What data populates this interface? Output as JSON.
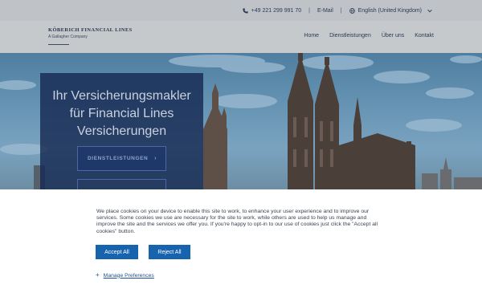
{
  "topbar": {
    "phone": "+49 221 299 991 70",
    "separator": "|",
    "email_label": "E-Mail",
    "language": "English (United Kingdom)"
  },
  "header": {
    "logo_name": "KÖBERICH FINANCIAL LINES",
    "logo_sub": "A Gallagher Company",
    "nav": [
      "Home",
      "Dienstleistungen",
      "Über uns",
      "Kontakt"
    ]
  },
  "hero": {
    "title_lines": [
      "Ihr Versicherungsmakler",
      "für Financial Lines",
      "Versicherungen"
    ],
    "button_label": "DIENSTLEISTUNGEN",
    "button_arrow": "›"
  },
  "cookie": {
    "text": "We place cookies on your device to enable this site to work, to enhance your user experience and to improve our services. Some cookies we use are necessary for the site to work, while others are used to help us manage and improve the site and the services we offer you. If you're happy to opt-in to our use of cookies just click the \"Accept all cookies\" button.",
    "accept_label": "Accept All",
    "reject_label": "Reject All",
    "manage_plus": "+",
    "manage_label": "Manage Preferences"
  },
  "colors": {
    "primary_button": "#1763ae",
    "hero_box": "#162a52",
    "topbar": "#bfc3c7"
  }
}
